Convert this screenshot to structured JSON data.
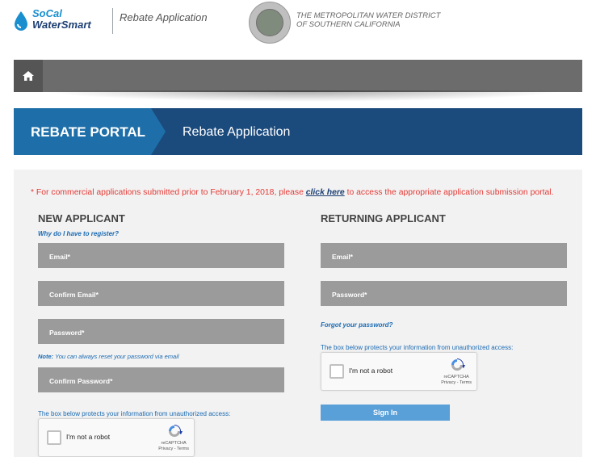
{
  "header": {
    "logo_line1": "SoCal",
    "logo_line2": "WaterSmart",
    "app_title": "Rebate Application",
    "org_line1": "THE METROPOLITAN WATER DISTRICT",
    "org_line2": "OF SOUTHERN CALIFORNIA"
  },
  "nav": {
    "home_icon": "home-icon"
  },
  "portal": {
    "label": "REBATE PORTAL",
    "subtitle": "Rebate Application"
  },
  "notice": {
    "prefix": "* For commercial applications submitted prior to February 1, 2018, please ",
    "link": "click here",
    "suffix": " to access the appropriate application submission portal."
  },
  "new_applicant": {
    "title": "NEW APPLICANT",
    "why_link": "Why do I have to register?",
    "email_placeholder": "Email*",
    "confirm_email_placeholder": "Confirm Email*",
    "password_placeholder": "Password*",
    "note_label": "Note:",
    "note_text": " You can always reset your password via email",
    "confirm_password_placeholder": "Confirm Password*",
    "protect_text": "The box below protects your information from unauthorized access:",
    "captcha_label": "I'm not a robot",
    "captcha_brand": "reCAPTCHA",
    "captcha_links": "Privacy - Terms"
  },
  "returning_applicant": {
    "title": "RETURNING APPLICANT",
    "email_placeholder": "Email*",
    "password_placeholder": "Password*",
    "forgot_link": "Forgot your password?",
    "protect_text": "The box below protects your information from unauthorized access:",
    "captcha_label": "I'm not a robot",
    "captcha_brand": "reCAPTCHA",
    "captcha_links": "Privacy - Terms",
    "signin_label": "Sign In"
  },
  "colors": {
    "nav_bg": "#6c6c6c",
    "portal_dark": "#1b4a7d",
    "portal_tab": "#1e6fa9",
    "notice_red": "#e53935",
    "link_blue": "#1a6ab3",
    "field_gray": "#9b9b9b",
    "signin_blue": "#5aa0d8"
  }
}
